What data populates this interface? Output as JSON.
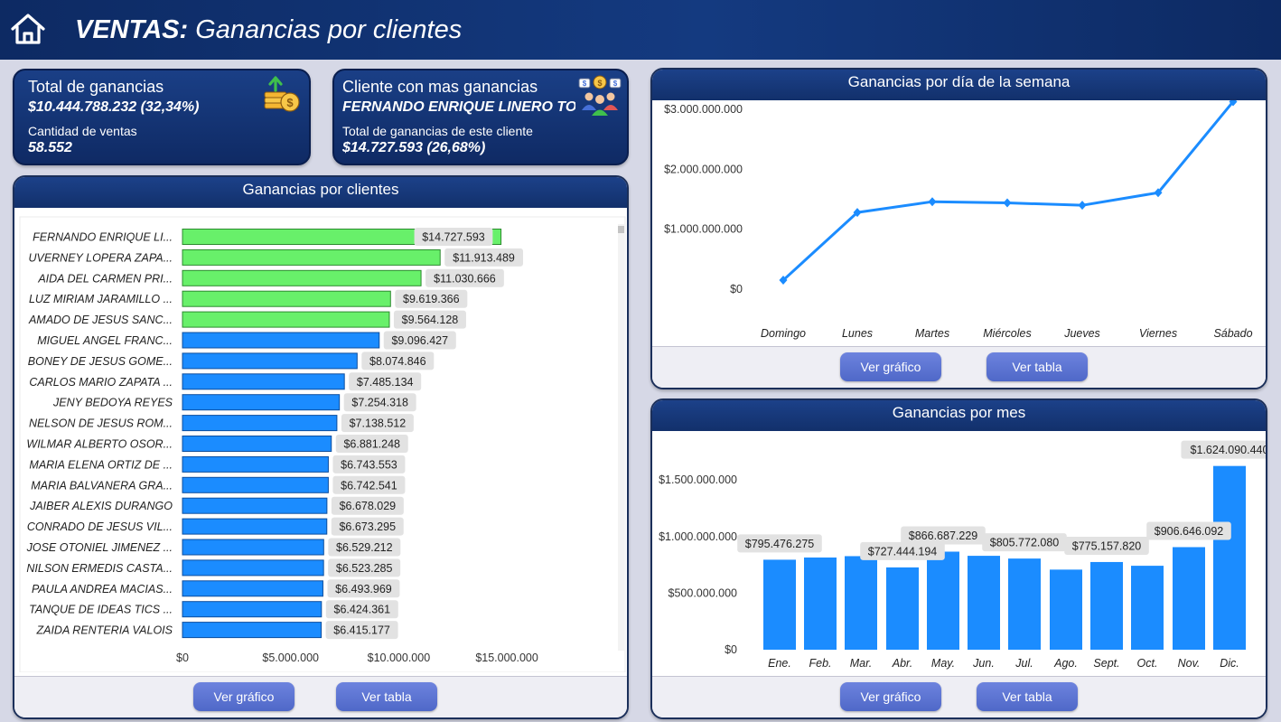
{
  "header": {
    "title_bold": "VENTAS:",
    "title_rest": " Ganancias por clientes"
  },
  "kpi_total": {
    "title": "Total de ganancias",
    "value": "$10.444.788.232 (32,34%)",
    "sub_label": "Cantidad de ventas",
    "sub_value": "58.552"
  },
  "kpi_client": {
    "title": "Cliente con mas ganancias",
    "value": "FERNANDO ENRIQUE LINERO TO...",
    "sub_label": "Total de ganancias de este cliente",
    "sub_value": "$14.727.593 (26,68%)"
  },
  "clients_panel": {
    "title": "Ganancias por clientes",
    "btn_chart": "Ver gráfico",
    "btn_table": "Ver tabla"
  },
  "weekday_panel": {
    "title": "Ganancias por día de la semana",
    "btn_chart": "Ver gráfico",
    "btn_table": "Ver tabla"
  },
  "month_panel": {
    "title": "Ganancias por mes",
    "btn_chart": "Ver gráfico",
    "btn_table": "Ver tabla"
  },
  "colors": {
    "highlight_bar": "#68f06a",
    "bar": "#1b8cff",
    "line": "#1b8cff",
    "header_bg": "#0d2a63"
  },
  "chart_data": [
    {
      "type": "bar",
      "orientation": "horizontal",
      "categories": [
        "FERNANDO ENRIQUE LI...",
        "UVERNEY LOPERA ZAPA...",
        "AIDA DEL CARMEN PRI...",
        "LUZ MIRIAM JARAMILLO ...",
        "AMADO DE JESUS SANC...",
        "MIGUEL ANGEL FRANC...",
        "BONEY DE JESUS GOME...",
        "CARLOS MARIO ZAPATA ...",
        "JENY BEDOYA REYES",
        "NELSON DE JESUS ROM...",
        "WILMAR ALBERTO OSOR...",
        "MARIA ELENA ORTIZ DE ...",
        "MARIA BALVANERA GRA...",
        "JAIBER ALEXIS DURANGO",
        "CONRADO DE JESUS VIL...",
        "JOSE OTONIEL JIMENEZ ...",
        "NILSON ERMEDIS CASTA...",
        "PAULA ANDREA MACIAS...",
        "TANQUE DE IDEAS TICS ...",
        "ZAIDA RENTERIA VALOIS"
      ],
      "values": [
        14727593,
        11913489,
        11030666,
        9619366,
        9564128,
        9096427,
        8074846,
        7485134,
        7254318,
        7138512,
        6881248,
        6743553,
        6742541,
        6678029,
        6673295,
        6529212,
        6523285,
        6493969,
        6424361,
        6415177
      ],
      "labels": [
        "$14.727.593",
        "$11.913.489",
        "$11.030.666",
        "$9.619.366",
        "$9.564.128",
        "$9.096.427",
        "$8.074.846",
        "$7.485.134",
        "$7.254.318",
        "$7.138.512",
        "$6.881.248",
        "$6.743.553",
        "$6.742.541",
        "$6.678.029",
        "$6.673.295",
        "$6.529.212",
        "$6.523.285",
        "$6.493.969",
        "$6.424.361",
        "$6.415.177"
      ],
      "highlight_top": 5,
      "xticks": [
        "$0",
        "$5.000.000",
        "$10.000.000",
        "$15.000.000"
      ],
      "xtick_values": [
        0,
        5000000,
        10000000,
        15000000
      ],
      "xlim": [
        0,
        15000000
      ]
    },
    {
      "type": "line",
      "categories": [
        "Domingo",
        "Lunes",
        "Martes",
        "Miércoles",
        "Jueves",
        "Viernes",
        "Sábado"
      ],
      "values": [
        150000000,
        1280000000,
        1460000000,
        1440000000,
        1400000000,
        1610000000,
        3130000000
      ],
      "yticks": [
        "$0",
        "$1.000.000.000",
        "$2.000.000.000",
        "$3.000.000.000"
      ],
      "ytick_values": [
        0,
        1000000000,
        2000000000,
        3000000000
      ],
      "ylim": [
        0,
        3300000000
      ]
    },
    {
      "type": "bar",
      "categories": [
        "Ene.",
        "Feb.",
        "Mar.",
        "Abr.",
        "May.",
        "Jun.",
        "Jul.",
        "Ago.",
        "Sept.",
        "Oct.",
        "Nov.",
        "Dic."
      ],
      "values": [
        795476275,
        815000000,
        827000000,
        727444194,
        866687229,
        830000000,
        805772080,
        708000000,
        775157820,
        742000000,
        906646092,
        1624090440
      ],
      "labels": [
        "$795.476.275",
        "",
        "",
        "$727.444.194",
        "$866.687.229",
        "",
        "$805.772.080",
        "",
        "$775.157.820",
        "",
        "$906.646.092",
        "$1.624.090.440"
      ],
      "yticks": [
        "$0",
        "$500.000.000",
        "$1.000.000.000",
        "$1.500.000.000"
      ],
      "ytick_values": [
        0,
        500000000,
        1000000000,
        1500000000
      ],
      "ylim": [
        0,
        1700000000
      ]
    }
  ]
}
